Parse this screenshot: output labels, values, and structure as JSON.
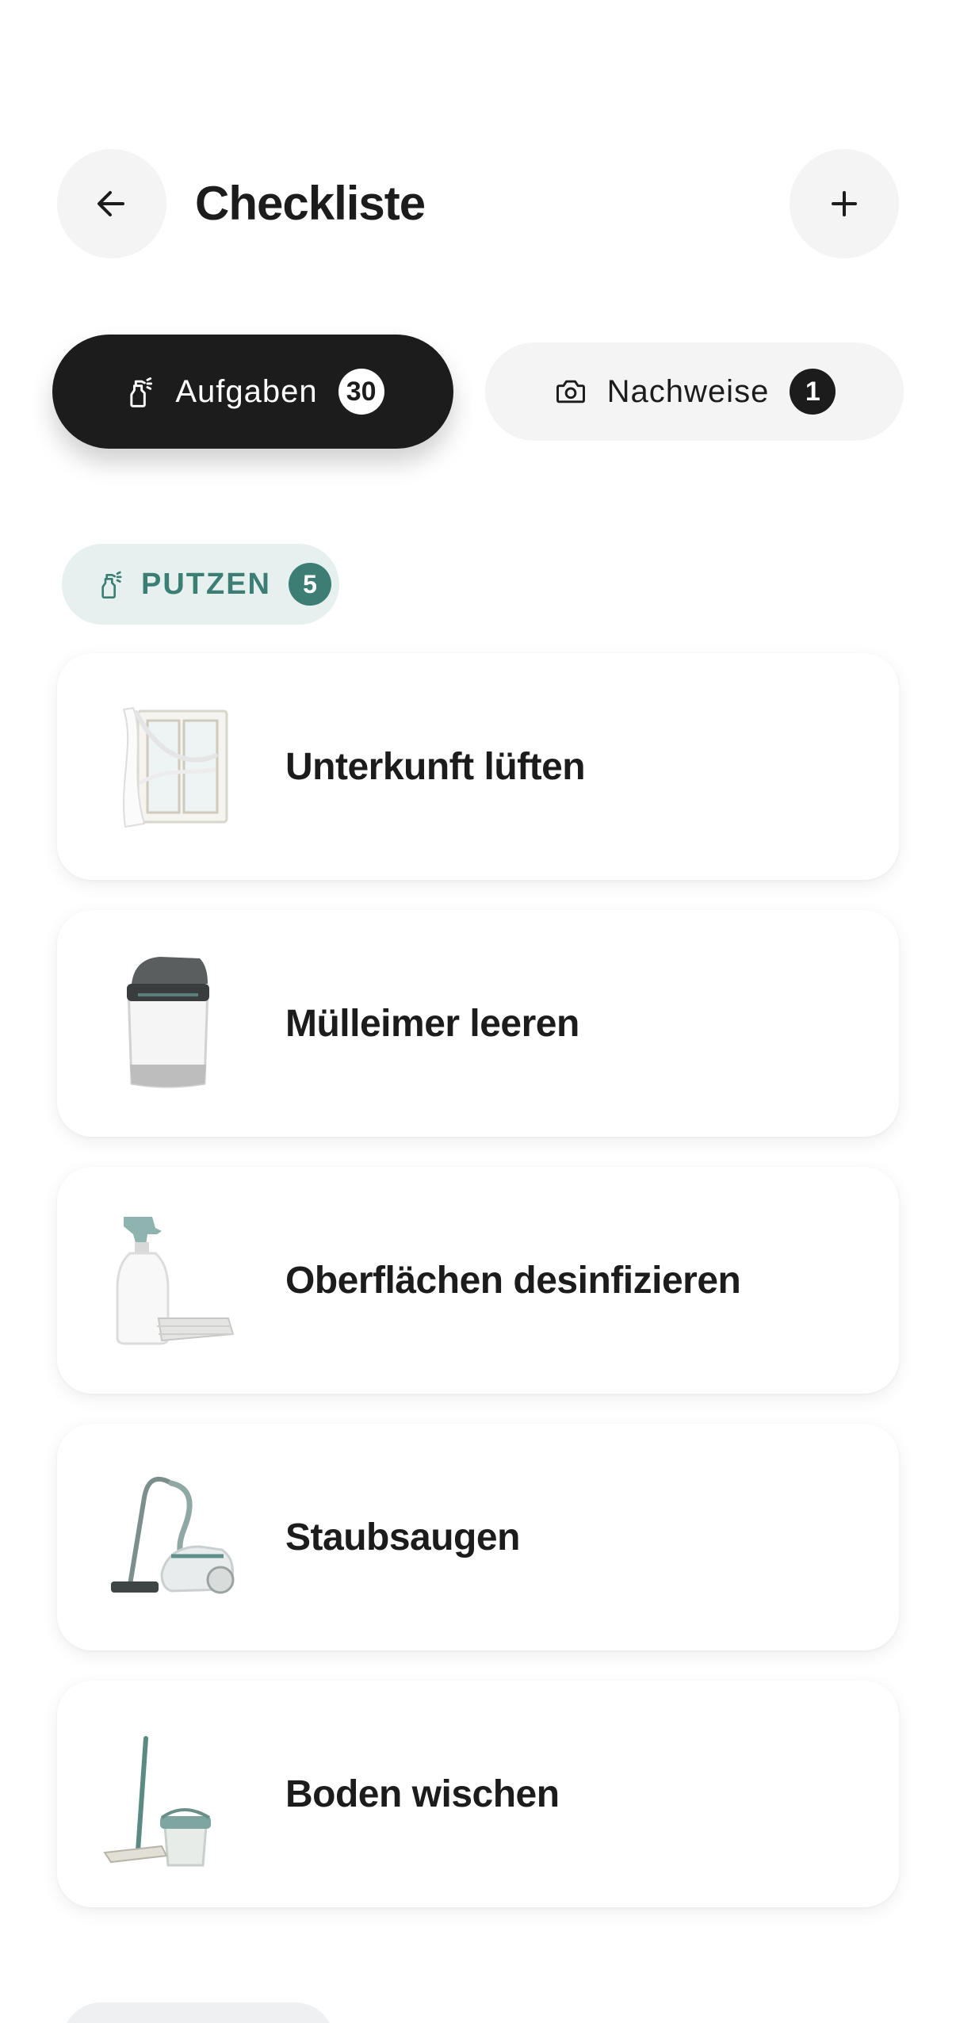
{
  "header": {
    "title": "Checkliste",
    "back_icon": "arrow-left-icon",
    "add_icon": "plus-icon"
  },
  "tabs": [
    {
      "label": "Aufgaben",
      "count": "30",
      "icon": "spray-bottle-icon",
      "active": true
    },
    {
      "label": "Nachweise",
      "count": "1",
      "icon": "camera-icon",
      "active": false
    }
  ],
  "category": {
    "label": "PUTZEN",
    "count": "5",
    "icon": "spray-bottle-icon",
    "color": "#3c7d74",
    "background": "#e6f1ef"
  },
  "tasks": [
    {
      "label": "Unterkunft lüften",
      "image": "window-curtain-image"
    },
    {
      "label": "Mülleimer leeren",
      "image": "trash-bin-image"
    },
    {
      "label": "Oberflächen desinfizieren",
      "image": "spray-bottle-cloth-image"
    },
    {
      "label": "Staubsaugen",
      "image": "vacuum-cleaner-image"
    },
    {
      "label": "Boden wischen",
      "image": "mop-bucket-image"
    }
  ],
  "colors": {
    "primary_dark": "#1c1c1c",
    "surface_light": "#f4f4f4",
    "accent_teal": "#3c7d74"
  }
}
